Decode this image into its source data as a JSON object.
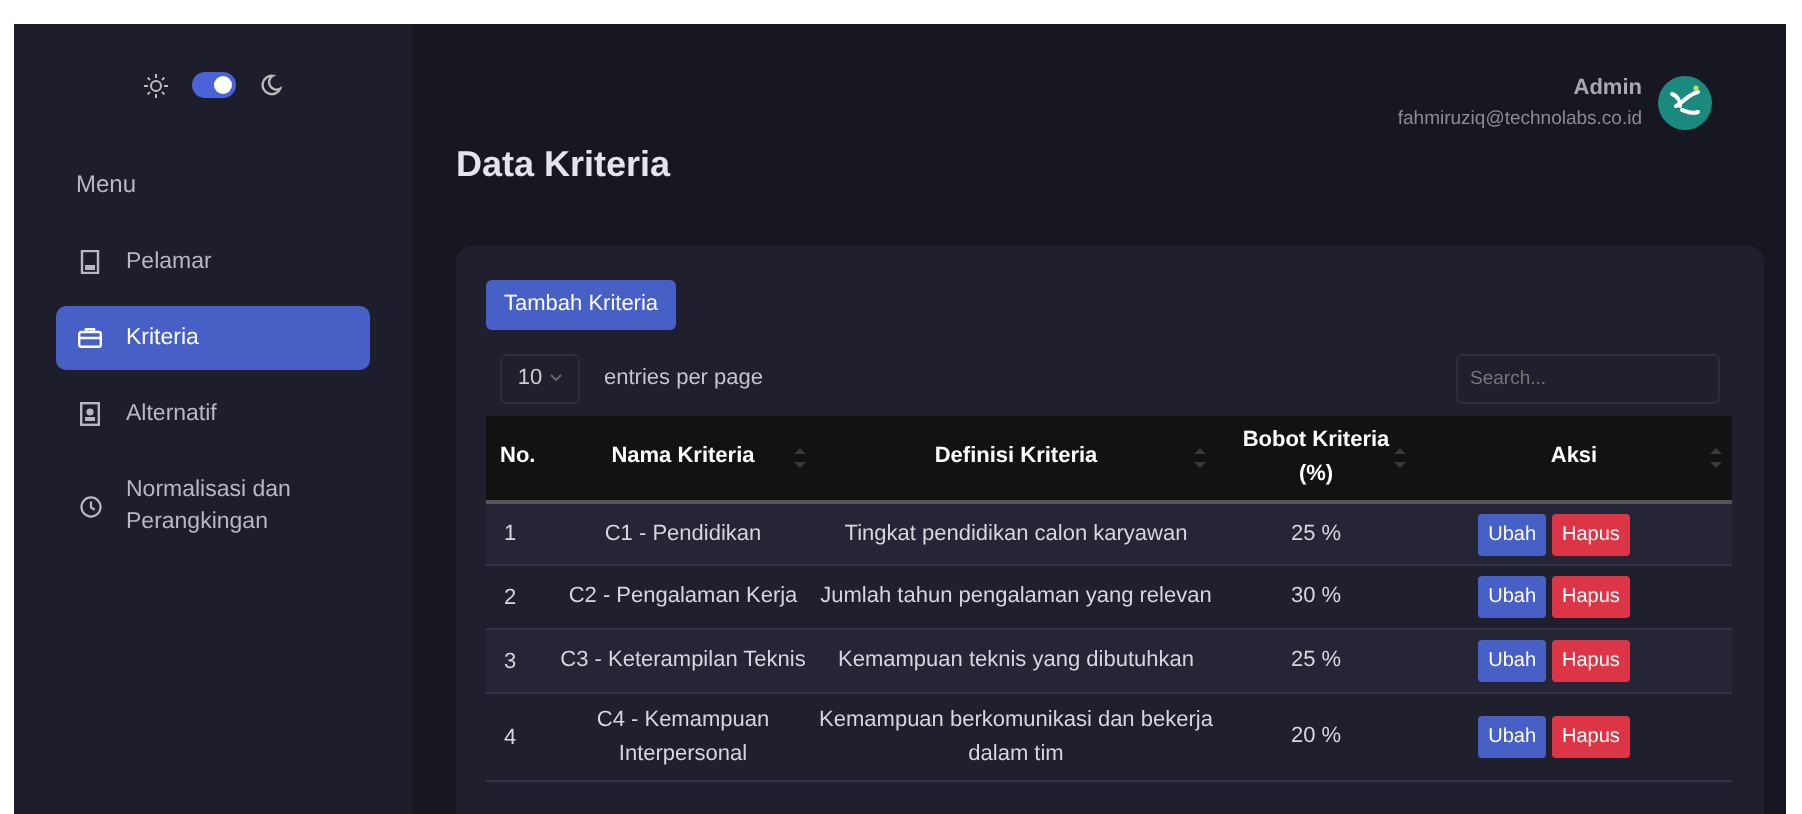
{
  "theme_toggle": {
    "on": true
  },
  "sidebar": {
    "heading": "Menu",
    "items": [
      {
        "label": "Pelamar",
        "selected": false
      },
      {
        "label": "Kriteria",
        "selected": true
      },
      {
        "label": "Alternatif",
        "selected": false
      },
      {
        "label": "Normalisasi dan Perangkingan",
        "selected": false
      }
    ]
  },
  "user": {
    "name": "Admin",
    "email": "fahmiruziq@technolabs.co.id"
  },
  "page_title": "Data Kriteria",
  "add_button": "Tambah Kriteria",
  "entries": {
    "value": "10",
    "label": "entries per page"
  },
  "search": {
    "placeholder": "Search..."
  },
  "table": {
    "columns": [
      {
        "label": "No.",
        "sortable": false
      },
      {
        "label": "Nama Kriteria",
        "sortable": true
      },
      {
        "label": "Definisi Kriteria",
        "sortable": true
      },
      {
        "label": "Bobot Kriteria (%)",
        "sortable": true
      },
      {
        "label": "Aksi",
        "sortable": true
      }
    ],
    "rows": [
      {
        "no": "1",
        "name": "C1 - Pendidikan",
        "definition": "Tingkat pendidikan calon karyawan",
        "weight": "25 %",
        "actions": [
          "Ubah",
          "Hapus"
        ]
      },
      {
        "no": "2",
        "name": "C2 - Pengalaman Kerja",
        "definition": "Jumlah tahun pengalaman yang relevan",
        "weight": "30 %",
        "actions": [
          "Ubah",
          "Hapus"
        ]
      },
      {
        "no": "3",
        "name": "C3 - Keterampilan Teknis",
        "definition": "Kemampuan teknis yang dibutuhkan",
        "weight": "25 %",
        "actions": [
          "Ubah",
          "Hapus"
        ]
      },
      {
        "no": "4",
        "name": "C4 - Kemampuan Interpersonal",
        "definition": "Kemampuan berkomunikasi dan bekerja dalam tim",
        "weight": "20 %",
        "actions": [
          "Ubah",
          "Hapus"
        ]
      }
    ]
  }
}
